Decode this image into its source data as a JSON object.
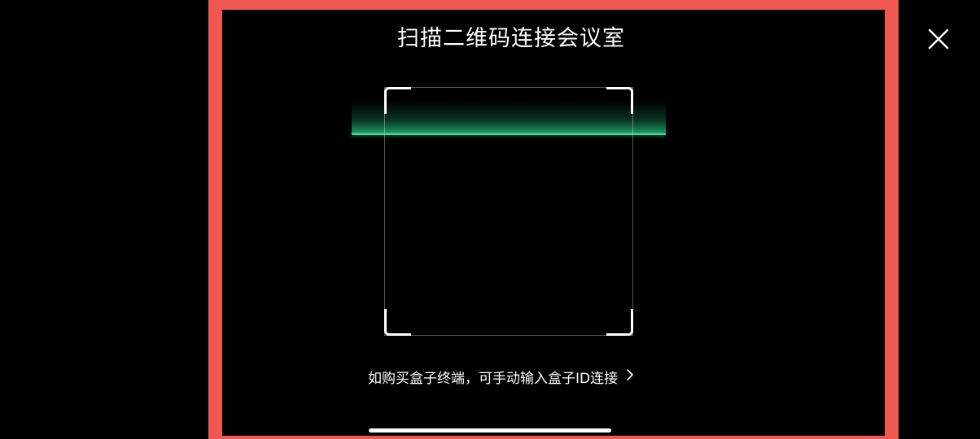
{
  "title": "扫描二维码连接会议室",
  "close": {
    "icon": "close-icon"
  },
  "scanner": {
    "frame_icon": "scan-frame",
    "line_color": "#3fdc98"
  },
  "manual_entry": {
    "label": "如购买盒子终端，可手动输入盒子ID连接",
    "icon": "chevron-right-icon"
  },
  "colors": {
    "background": "#000000",
    "highlight": "#ee5850",
    "text": "#ffffff",
    "accent": "#3fdc98"
  }
}
